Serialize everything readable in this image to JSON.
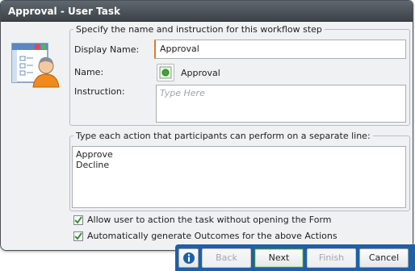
{
  "window": {
    "title": "Approval - User Task"
  },
  "step_group": {
    "legend": "Specify the name and instruction for this workflow step",
    "display_name_label": "Display Name:",
    "display_name_value": "Approval",
    "name_label": "Name:",
    "name_value": "Approval",
    "instruction_label": "Instruction:",
    "instruction_placeholder": "Type Here"
  },
  "actions_group": {
    "legend": "Type each action that participants can perform on a separate line:",
    "lines": [
      "Approve",
      "Decline"
    ]
  },
  "options": {
    "allow_action_label": "Allow user to action the task without opening the Form",
    "allow_action_checked": true,
    "auto_outcomes_label": "Automatically generate Outcomes for the above Actions",
    "auto_outcomes_checked": true
  },
  "buttons": {
    "back": "Back",
    "next": "Next",
    "finish": "Finish",
    "cancel": "Cancel",
    "info_icon": "info-icon"
  },
  "colors": {
    "title_bar": "#4a5058",
    "button_bar": "#1f5fa8",
    "focus_accent": "#e07a2e",
    "check_mark": "#3c8a36"
  }
}
